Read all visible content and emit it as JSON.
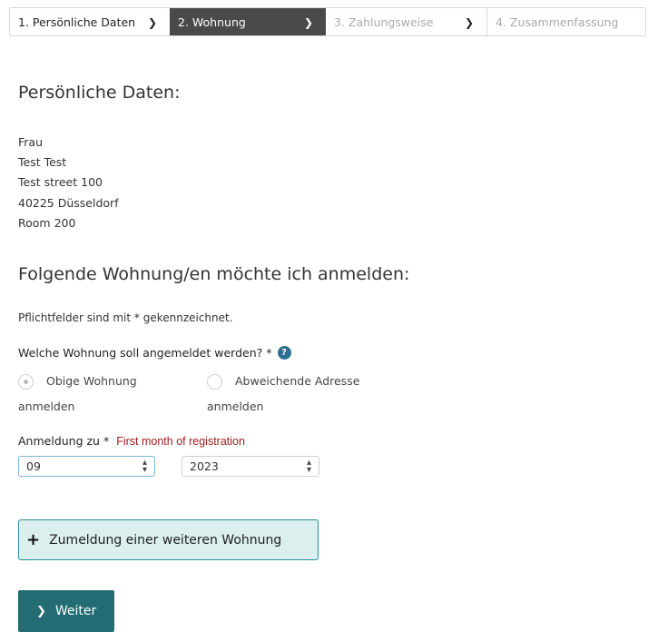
{
  "stepper": {
    "steps": [
      {
        "label": "1. Persönliche Daten"
      },
      {
        "label": "2. Wohnung"
      },
      {
        "label": "3. Zahlungsweise"
      },
      {
        "label": "4. Zusammenfassung"
      }
    ]
  },
  "personal": {
    "heading": "Persönliche Daten:",
    "lines": [
      "Frau",
      "Test Test",
      "Test street 100",
      "40225 Düsseldorf",
      "Room 200"
    ]
  },
  "apartment": {
    "heading": "Folgende Wohnung/en möchte ich anmelden:",
    "required_note": "Pflichtfelder sind mit * gekennzeichnet.",
    "question": "Welche Wohnung soll angemeldet werden? *",
    "help_icon": "?",
    "options": [
      {
        "line1": "Obige Wohnung",
        "line2": "anmelden",
        "checked": true
      },
      {
        "line1": "Abweichende Adresse",
        "line2": "anmelden",
        "checked": false
      }
    ],
    "registration_label": "Anmeldung zu *",
    "registration_hint": "First month of registration",
    "month_value": "09",
    "year_value": "2023",
    "add_button": "Zumeldung einer weiteren Wohnung"
  },
  "footer": {
    "next_label": "Weiter"
  }
}
